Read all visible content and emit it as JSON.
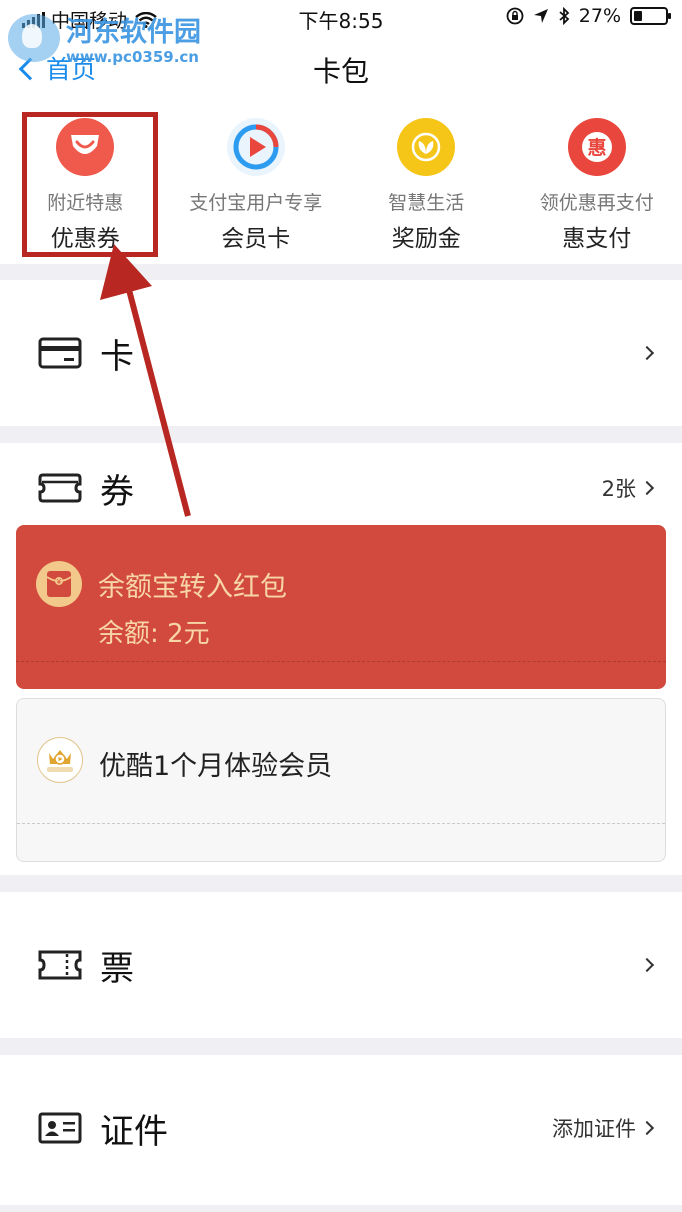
{
  "status_bar": {
    "carrier": "中国移动",
    "time": "下午8:55",
    "battery": "27%",
    "battery_level": 0.27
  },
  "watermark": {
    "title": "河东软件园",
    "url": "www.pc0359.cn"
  },
  "nav": {
    "back_label": "首页",
    "title": "卡包"
  },
  "top_grid": [
    {
      "sub": "附近特惠",
      "main": "优惠券",
      "icon": "smile-bag-icon",
      "color": "#ef5a4c"
    },
    {
      "sub": "支付宝用户专享",
      "main": "会员卡",
      "icon": "play-circle-icon",
      "color": "#2d9cf0"
    },
    {
      "sub": "智慧生活",
      "main": "奖励金",
      "icon": "leaf-coin-icon",
      "color": "#f5c518"
    },
    {
      "sub": "领优惠再支付",
      "main": "惠支付",
      "icon": "hui-icon",
      "icon_text": "惠",
      "color": "#e9473d"
    }
  ],
  "sections": {
    "card": {
      "title": "卡"
    },
    "coupon": {
      "title": "券",
      "count": "2张"
    },
    "ticket": {
      "title": "票"
    },
    "id": {
      "title": "证件",
      "action": "添加证件"
    }
  },
  "coupons": [
    {
      "title": "余额宝转入红包",
      "subtitle": "余额: 2元",
      "icon": "red-envelope-icon",
      "icon_text": "¥",
      "bg": "#d24a3d"
    },
    {
      "title": "优酷1个月体验会员",
      "icon": "youku-vip-icon",
      "bg": "#f7f7f7"
    }
  ]
}
